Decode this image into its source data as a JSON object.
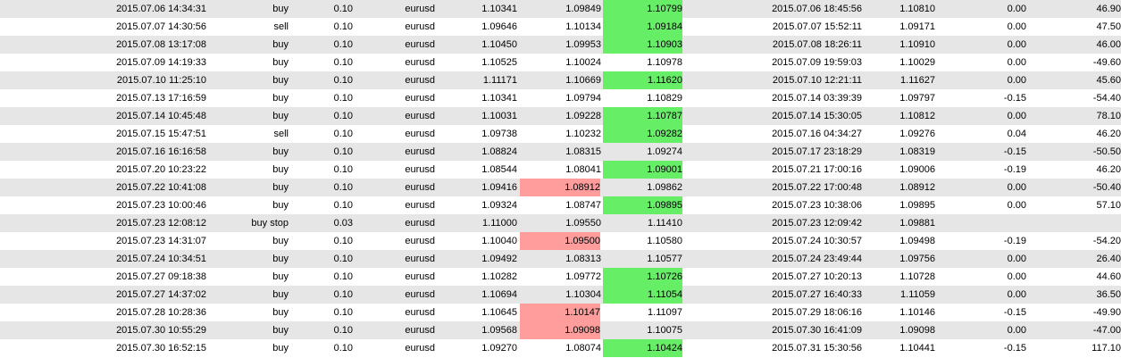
{
  "colors": {
    "row_alt": "#e6e6e6",
    "stop_loss_hit": "#ff9c9c",
    "take_profit_hit": "#66ee66"
  },
  "rows": [
    {
      "open_time": "2015.07.06 14:34:31",
      "type": "buy",
      "size": "0.10",
      "symbol": "eurusd",
      "price": "1.10341",
      "sl": "1.09849",
      "tp": "1.10799",
      "close_time": "2015.07.06 18:45:56",
      "close_price": "1.10810",
      "commission": "0.00",
      "profit": "46.90",
      "sl_hit": false,
      "tp_hit": true
    },
    {
      "open_time": "2015.07.07 14:30:56",
      "type": "sell",
      "size": "0.10",
      "symbol": "eurusd",
      "price": "1.09646",
      "sl": "1.10134",
      "tp": "1.09184",
      "close_time": "2015.07.07 15:52:11",
      "close_price": "1.09171",
      "commission": "0.00",
      "profit": "47.50",
      "sl_hit": false,
      "tp_hit": true
    },
    {
      "open_time": "2015.07.08 13:17:08",
      "type": "buy",
      "size": "0.10",
      "symbol": "eurusd",
      "price": "1.10450",
      "sl": "1.09953",
      "tp": "1.10903",
      "close_time": "2015.07.08 18:26:11",
      "close_price": "1.10910",
      "commission": "0.00",
      "profit": "46.00",
      "sl_hit": false,
      "tp_hit": true
    },
    {
      "open_time": "2015.07.09 14:19:33",
      "type": "buy",
      "size": "0.10",
      "symbol": "eurusd",
      "price": "1.10525",
      "sl": "1.10024",
      "tp": "1.10978",
      "close_time": "2015.07.09 19:59:03",
      "close_price": "1.10029",
      "commission": "0.00",
      "profit": "-49.60",
      "sl_hit": false,
      "tp_hit": false
    },
    {
      "open_time": "2015.07.10 11:25:10",
      "type": "buy",
      "size": "0.10",
      "symbol": "eurusd",
      "price": "1.11171",
      "sl": "1.10669",
      "tp": "1.11620",
      "close_time": "2015.07.10 12:21:11",
      "close_price": "1.11627",
      "commission": "0.00",
      "profit": "45.60",
      "sl_hit": false,
      "tp_hit": true
    },
    {
      "open_time": "2015.07.13 17:16:59",
      "type": "buy",
      "size": "0.10",
      "symbol": "eurusd",
      "price": "1.10341",
      "sl": "1.09794",
      "tp": "1.10829",
      "close_time": "2015.07.14 03:39:39",
      "close_price": "1.09797",
      "commission": "-0.15",
      "profit": "-54.40",
      "sl_hit": false,
      "tp_hit": false
    },
    {
      "open_time": "2015.07.14 10:45:48",
      "type": "buy",
      "size": "0.10",
      "symbol": "eurusd",
      "price": "1.10031",
      "sl": "1.09228",
      "tp": "1.10787",
      "close_time": "2015.07.14 15:30:05",
      "close_price": "1.10812",
      "commission": "0.00",
      "profit": "78.10",
      "sl_hit": false,
      "tp_hit": true
    },
    {
      "open_time": "2015.07.15 15:47:51",
      "type": "sell",
      "size": "0.10",
      "symbol": "eurusd",
      "price": "1.09738",
      "sl": "1.10232",
      "tp": "1.09282",
      "close_time": "2015.07.16 04:34:27",
      "close_price": "1.09276",
      "commission": "0.04",
      "profit": "46.20",
      "sl_hit": false,
      "tp_hit": true
    },
    {
      "open_time": "2015.07.16 16:16:58",
      "type": "buy",
      "size": "0.10",
      "symbol": "eurusd",
      "price": "1.08824",
      "sl": "1.08315",
      "tp": "1.09274",
      "close_time": "2015.07.17 23:18:29",
      "close_price": "1.08319",
      "commission": "-0.15",
      "profit": "-50.50",
      "sl_hit": false,
      "tp_hit": false
    },
    {
      "open_time": "2015.07.20 10:23:22",
      "type": "buy",
      "size": "0.10",
      "symbol": "eurusd",
      "price": "1.08544",
      "sl": "1.08041",
      "tp": "1.09001",
      "close_time": "2015.07.21 17:00:16",
      "close_price": "1.09006",
      "commission": "-0.19",
      "profit": "46.20",
      "sl_hit": false,
      "tp_hit": true
    },
    {
      "open_time": "2015.07.22 10:41:08",
      "type": "buy",
      "size": "0.10",
      "symbol": "eurusd",
      "price": "1.09416",
      "sl": "1.08912",
      "tp": "1.09862",
      "close_time": "2015.07.22 17:00:48",
      "close_price": "1.08912",
      "commission": "0.00",
      "profit": "-50.40",
      "sl_hit": true,
      "tp_hit": false
    },
    {
      "open_time": "2015.07.23 10:00:46",
      "type": "buy",
      "size": "0.10",
      "symbol": "eurusd",
      "price": "1.09324",
      "sl": "1.08747",
      "tp": "1.09895",
      "close_time": "2015.07.23 10:38:06",
      "close_price": "1.09895",
      "commission": "0.00",
      "profit": "57.10",
      "sl_hit": false,
      "tp_hit": true
    },
    {
      "open_time": "2015.07.23 12:08:12",
      "type": "buy stop",
      "size": "0.03",
      "symbol": "eurusd",
      "price": "1.11000",
      "sl": "1.09550",
      "tp": "1.11410",
      "close_time": "2015.07.23 12:09:42",
      "close_price": "1.09881",
      "commission": "",
      "profit": "",
      "sl_hit": false,
      "tp_hit": false
    },
    {
      "open_time": "2015.07.23 14:31:07",
      "type": "buy",
      "size": "0.10",
      "symbol": "eurusd",
      "price": "1.10040",
      "sl": "1.09500",
      "tp": "1.10580",
      "close_time": "2015.07.24 10:30:57",
      "close_price": "1.09498",
      "commission": "-0.19",
      "profit": "-54.20",
      "sl_hit": true,
      "tp_hit": false
    },
    {
      "open_time": "2015.07.24 10:34:51",
      "type": "buy",
      "size": "0.10",
      "symbol": "eurusd",
      "price": "1.09492",
      "sl": "1.08313",
      "tp": "1.10577",
      "close_time": "2015.07.24 23:49:44",
      "close_price": "1.09756",
      "commission": "0.00",
      "profit": "26.40",
      "sl_hit": false,
      "tp_hit": false
    },
    {
      "open_time": "2015.07.27 09:18:38",
      "type": "buy",
      "size": "0.10",
      "symbol": "eurusd",
      "price": "1.10282",
      "sl": "1.09772",
      "tp": "1.10726",
      "close_time": "2015.07.27 10:20:13",
      "close_price": "1.10728",
      "commission": "0.00",
      "profit": "44.60",
      "sl_hit": false,
      "tp_hit": true
    },
    {
      "open_time": "2015.07.27 14:37:02",
      "type": "buy",
      "size": "0.10",
      "symbol": "eurusd",
      "price": "1.10694",
      "sl": "1.10304",
      "tp": "1.11054",
      "close_time": "2015.07.27 16:40:33",
      "close_price": "1.11059",
      "commission": "0.00",
      "profit": "36.50",
      "sl_hit": false,
      "tp_hit": true
    },
    {
      "open_time": "2015.07.28 10:28:36",
      "type": "buy",
      "size": "0.10",
      "symbol": "eurusd",
      "price": "1.10645",
      "sl": "1.10147",
      "tp": "1.11097",
      "close_time": "2015.07.29 18:06:16",
      "close_price": "1.10146",
      "commission": "-0.15",
      "profit": "-49.90",
      "sl_hit": true,
      "tp_hit": false
    },
    {
      "open_time": "2015.07.30 10:55:29",
      "type": "buy",
      "size": "0.10",
      "symbol": "eurusd",
      "price": "1.09568",
      "sl": "1.09098",
      "tp": "1.10075",
      "close_time": "2015.07.30 16:41:09",
      "close_price": "1.09098",
      "commission": "0.00",
      "profit": "-47.00",
      "sl_hit": true,
      "tp_hit": false
    },
    {
      "open_time": "2015.07.30 16:52:15",
      "type": "buy",
      "size": "0.10",
      "symbol": "eurusd",
      "price": "1.09270",
      "sl": "1.08074",
      "tp": "1.10424",
      "close_time": "2015.07.31 15:30:56",
      "close_price": "1.10441",
      "commission": "-0.15",
      "profit": "117.10",
      "sl_hit": false,
      "tp_hit": true
    }
  ]
}
